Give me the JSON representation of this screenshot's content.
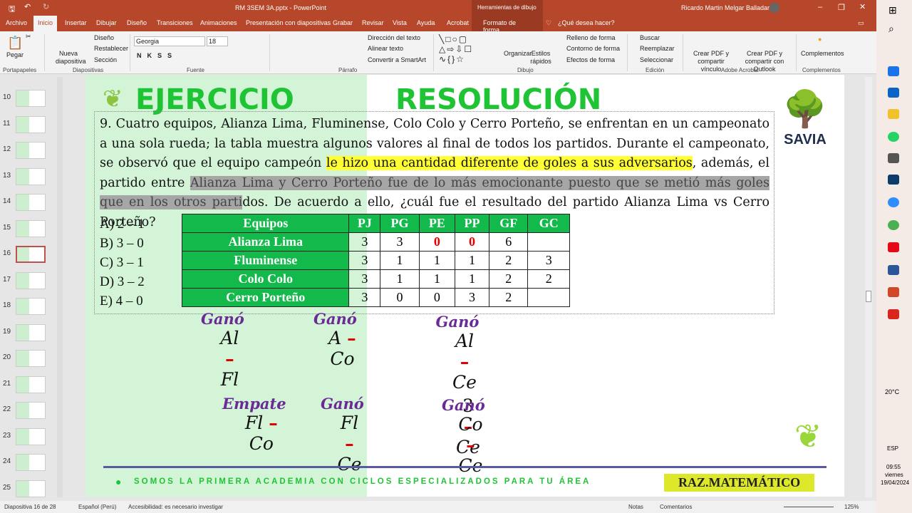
{
  "window": {
    "file_title": "RM 3SEM 3A.pptx  -  PowerPoint",
    "context_tab": "Herramientas de dibujo",
    "user": "Ricardo Martin Melgar Balladares"
  },
  "tabs": [
    "Archivo",
    "Inicio",
    "Insertar",
    "Dibujar",
    "Diseño",
    "Transiciones",
    "Animaciones",
    "Presentación con diapositivas",
    "Grabar",
    "Revisar",
    "Vista",
    "Ayuda",
    "Acrobat",
    "Formato de forma",
    "¿Qué desea hacer?"
  ],
  "ribbon": {
    "pegar": "Pegar",
    "nueva": "Nueva diapositiva",
    "diseno": "Diseño",
    "restablecer": "Restablecer",
    "seccion": "Sección",
    "font": "Georgia",
    "size": "18",
    "dir": "Dirección del texto",
    "alinear": "Alinear texto",
    "smartart": "Convertir a SmartArt",
    "organizar": "Organizar",
    "estilos": "Estilos rápidos",
    "relleno": "Relleno de forma",
    "contorno": "Contorno de forma",
    "efectos": "Efectos de forma",
    "buscar": "Buscar",
    "reemplazar": "Reemplazar",
    "seleccionar": "Seleccionar",
    "pdf1": "Crear PDF y compartir vínculo",
    "pdf2": "Crear PDF y compartir con Outlook",
    "complementos": "Complementos",
    "groups": [
      "Portapapeles",
      "Diapositivas",
      "Fuente",
      "Párrafo",
      "Dibujo",
      "Edición",
      "Adobe Acrobat",
      "Complementos"
    ]
  },
  "thumbs": [
    "10",
    "11",
    "12",
    "13",
    "14",
    "15",
    "16",
    "17",
    "18",
    "19",
    "20",
    "21",
    "22",
    "23",
    "24",
    "25"
  ],
  "slide": {
    "title_left": "EJERCICIO",
    "title_right": "RESOLUCIÓN",
    "logo": "SAVIA",
    "p1": "9. Cuatro equipos, Alianza Lima, Fluminense, Colo Colo y Cerro Porteño, se enfrentan en un campeonato a una sola rueda; la tabla muestra algunos valores al final de todos los partidos. Durante el campeonato, se observó que el equipo campeón ",
    "p_hl": "le hizo una cantidad diferente de goles a sus adversarios",
    "p2": ", además, el partido entre ",
    "p_sel": "Alianza Lima y Cerro Porteño fue de lo más emocionante puesto que se metió más goles que en los otros parti",
    "p3": "dos. De acuerdo a ello, ¿cuál fue el resultado del partido Alianza Lima vs Cerro Porteño?",
    "options": [
      "A) 2 – 1",
      "B) 3 – 0",
      "C) 3 – 1",
      "D) 3 – 2",
      "E) 4 – 0"
    ],
    "table": {
      "headers": [
        "Equipos",
        "PJ",
        "PG",
        "PE",
        "PP",
        "GF",
        "GC"
      ],
      "rows": [
        [
          "Alianza Lima",
          "3",
          "3",
          "0",
          "0",
          "6",
          ""
        ],
        [
          "Fluminense",
          "3",
          "1",
          "1",
          "1",
          "2",
          "3"
        ],
        [
          "Colo Colo",
          "3",
          "1",
          "1",
          "1",
          "2",
          "2"
        ],
        [
          "Cerro Porteño",
          "3",
          "0",
          "0",
          "3",
          "2",
          ""
        ]
      ]
    },
    "notes": [
      {
        "label": "Ganó",
        "a": "Al",
        "b": "Fl"
      },
      {
        "label": "Ganó",
        "a": "A",
        "b": "Co"
      },
      {
        "label": "Ganó",
        "a": "Al",
        "b": "Ce",
        "c": "3",
        "d": "Ce"
      },
      {
        "label": "Empate",
        "a": "Fl",
        "b": "Co"
      },
      {
        "label": "Ganó",
        "a": "Fl",
        "b": "Ce"
      },
      {
        "label": "Ganó",
        "a": "Co",
        "b": "Ce"
      }
    ],
    "dash": "–",
    "footer": "SOMOS LA PRIMERA ACADEMIA CON CICLOS ESPECIALIZADOS PARA TU ÁREA",
    "badge": "RAZ.MATEMÁTICO"
  },
  "status": {
    "slide": "Diapositiva 16 de 28",
    "lang": "Español (Perú)",
    "acc": "Accesibilidad: es necesario investigar",
    "notas": "Notas",
    "comentarios": "Comentarios",
    "zoom": "125%"
  },
  "taskbar": {
    "temp": "20°C",
    "lang": "ESP",
    "time": "09:55",
    "day": "viernes",
    "date": "19/04/2024"
  }
}
